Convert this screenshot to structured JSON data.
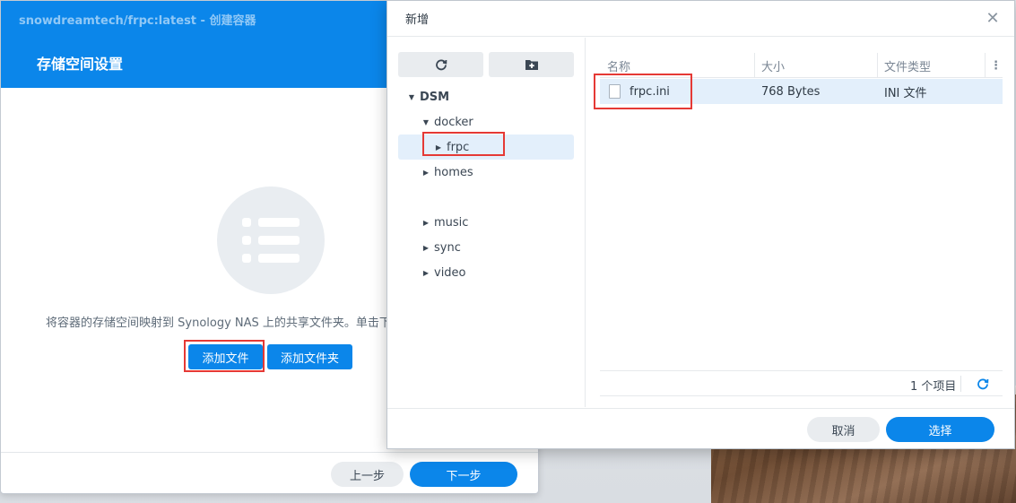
{
  "main_window": {
    "title": "snowdreamtech/frpc:latest - 创建容器",
    "header": "存储空间设置",
    "description": "将容器的存储空间映射到 Synology NAS 上的共享文件夹。单击下",
    "add_file_label": "添加文件",
    "add_folder_label": "添加文件夹",
    "prev_label": "上一步",
    "next_label": "下一步"
  },
  "dialog": {
    "title": "新增",
    "close_icon": "close-icon",
    "toolbar": {
      "refresh_icon": "refresh-icon",
      "new_folder_icon": "new-folder-icon"
    },
    "tree": {
      "root": "DSM",
      "items": [
        {
          "label": "docker",
          "expanded": true
        },
        {
          "label": "frpc",
          "selected": true
        },
        {
          "label": "homes"
        },
        {
          "label": "music"
        },
        {
          "label": "sync"
        },
        {
          "label": "video"
        }
      ]
    },
    "columns": [
      "名称",
      "大小",
      "文件类型"
    ],
    "files": [
      {
        "name": "frpc.ini",
        "size": "768 Bytes",
        "type": "INI 文件"
      }
    ],
    "item_count": "1 个项目",
    "cancel_label": "取消",
    "select_label": "选择"
  },
  "colors": {
    "accent": "#0b86ea",
    "selection": "#e3effb",
    "highlight": "#e53935"
  }
}
